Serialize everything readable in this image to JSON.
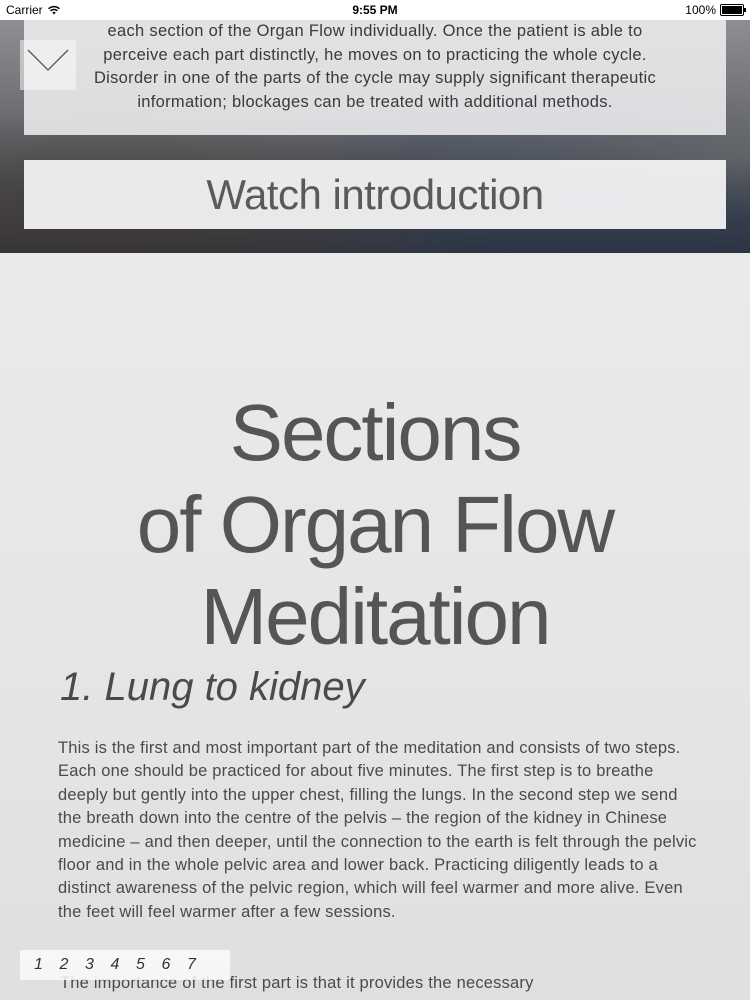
{
  "status_bar": {
    "carrier": "Carrier",
    "time": "9:55 PM",
    "battery": "100%"
  },
  "intro": {
    "line1": "each section of the Organ Flow individually. Once the patient is able to",
    "line2": "perceive each part distinctly, he moves on to practicing the whole cycle.",
    "line3": "Disorder in one of the parts of the cycle may supply significant therapeutic",
    "line4": "information; blockages can be treated with additional methods."
  },
  "watch_button_label": "Watch introduction",
  "section_title": {
    "line1": "Sections",
    "line2": "of Organ Flow",
    "line3": "Meditation"
  },
  "subsection": {
    "heading": "1. Lung to kidney",
    "paragraph1": "This is the first and most important part of the meditation and consists of two steps. Each one should be practiced for about five minutes. The first step is to breathe deeply but gently into the upper chest, filling the lungs. In the second step we send the breath down into the centre of the pelvis – the region of the kidney in Chinese medicine – and then deeper, until the connection to the earth is felt through the pelvic floor and in the whole pelvic area and lower back. Practicing diligently leads to a distinct awareness of the pelvic region, which will feel warmer and more alive. Even the feet will feel warmer after a few sessions.",
    "paragraph2_start": "The importance of the first part is that it provides the necessary"
  },
  "page_index": [
    "1",
    "2",
    "3",
    "4",
    "5",
    "6",
    "7"
  ],
  "icons": {
    "collapse": "chevron-down-icon",
    "wifi": "wifi-icon",
    "battery": "battery-icon"
  }
}
